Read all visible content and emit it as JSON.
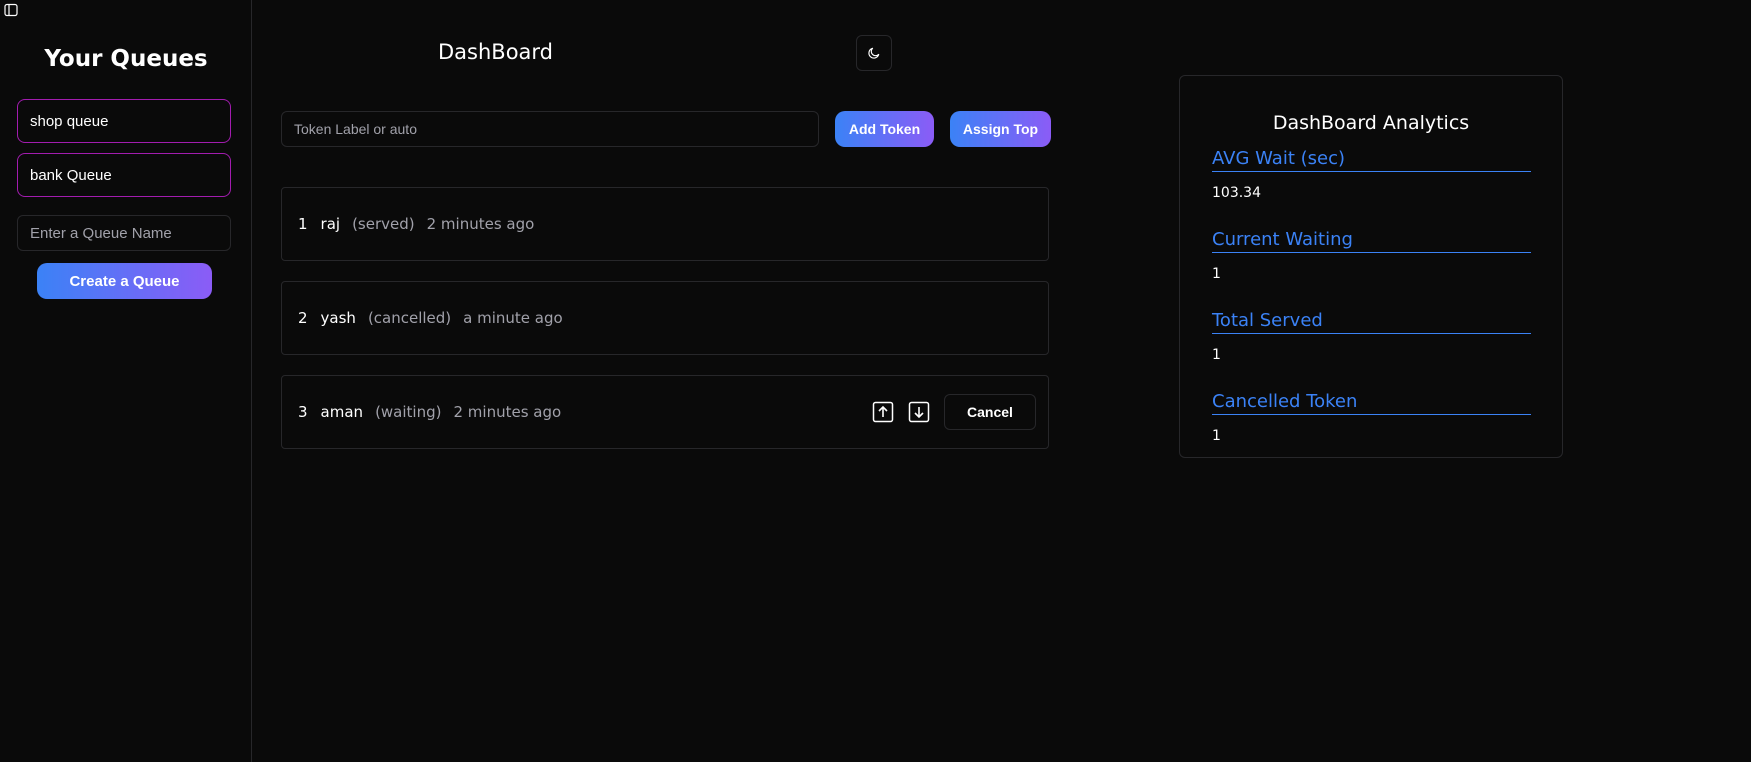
{
  "sidebar": {
    "title": "Your Queues",
    "queues": [
      {
        "label": "shop queue"
      },
      {
        "label": "bank Queue"
      }
    ],
    "queue_name_placeholder": "Enter a Queue Name",
    "create_button": "Create a Queue"
  },
  "main": {
    "title": "DashBoard",
    "token_placeholder": "Token Label or auto",
    "add_button": "Add Token",
    "assign_button": "Assign Top",
    "tokens": [
      {
        "number": "1",
        "name": "raj",
        "status": "(served)",
        "time": "2 minutes ago"
      },
      {
        "number": "2",
        "name": "yash",
        "status": "(cancelled)",
        "time": "a minute ago"
      },
      {
        "number": "3",
        "name": "aman",
        "status": "(waiting)",
        "time": "2 minutes ago",
        "cancel_label": "Cancel"
      }
    ]
  },
  "analytics": {
    "title": "DashBoard Analytics",
    "metrics": [
      {
        "label": "AVG Wait (sec)",
        "value": "103.34"
      },
      {
        "label": "Current Waiting",
        "value": "1"
      },
      {
        "label": "Total Served",
        "value": "1"
      },
      {
        "label": "Cancelled Token",
        "value": "1"
      }
    ]
  },
  "colors": {
    "background": "#0a0a0a",
    "accent": "#3b82f6",
    "gradient_end": "#8b5cf6",
    "queue_border": "#a21caf",
    "muted_text": "#a1a1aa"
  }
}
